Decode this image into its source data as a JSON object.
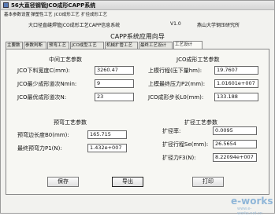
{
  "window": {
    "title": "56大直径钢管JCO成形CAPP系统"
  },
  "menu": [
    "基本参数设置",
    "弹塑性工艺",
    "JCO成形工艺",
    "扩径成形工艺"
  ],
  "header": {
    "left": "大口径直缝焊管JCO成形工艺CAPP信息系统",
    "version": "V1.0",
    "company": "燕山大学钢压研究所"
  },
  "app_title": "CAPP系统应用向导",
  "tabs": [
    "主要数",
    "参数判断",
    "预弯工艺",
    "JCO成型工艺",
    "机械扩管工艺",
    "最终工艺设计",
    "工艺设计"
  ],
  "jc": {
    "title": "中间工艺参数",
    "rows": [
      {
        "label": "JCO下料宽度C(mm):",
        "value": "3260.47"
      },
      {
        "label": "JCO最少成形道次Nmin:",
        "value": "9"
      },
      {
        "label": "JCO最优成形道次N:",
        "value": "23"
      }
    ]
  },
  "jco": {
    "title": "JCO成形工艺参数",
    "rows": [
      {
        "label": "上模行程(压下量hm):",
        "value": "19.7607"
      },
      {
        "label": "上模最终压力P2(mm):",
        "value": "1.01601e+007"
      },
      {
        "label": "JCO成形步长L0(mm):",
        "value": "133.188"
      }
    ]
  },
  "pre": {
    "title": "预弯工艺参数",
    "rows": [
      {
        "label": "预弯边长度B0(mm):",
        "value": "165.715"
      },
      {
        "label": "最终预弯力P1(N):",
        "value": "1.432e+007"
      }
    ]
  },
  "exp": {
    "title": "扩径工艺参数",
    "rows": [
      {
        "label": "扩径率:",
        "value": "0.0095"
      },
      {
        "label": "扩径行程Se(mm):",
        "value": "26.5654"
      },
      {
        "label": "扩径力F3(N):",
        "value": "8.22094e+007"
      }
    ]
  },
  "buttons": {
    "save": "保存",
    "export": "导出",
    "print": "打印"
  },
  "watermark": "e-works",
  "watermark_sub": "www.e-works.net.cn"
}
